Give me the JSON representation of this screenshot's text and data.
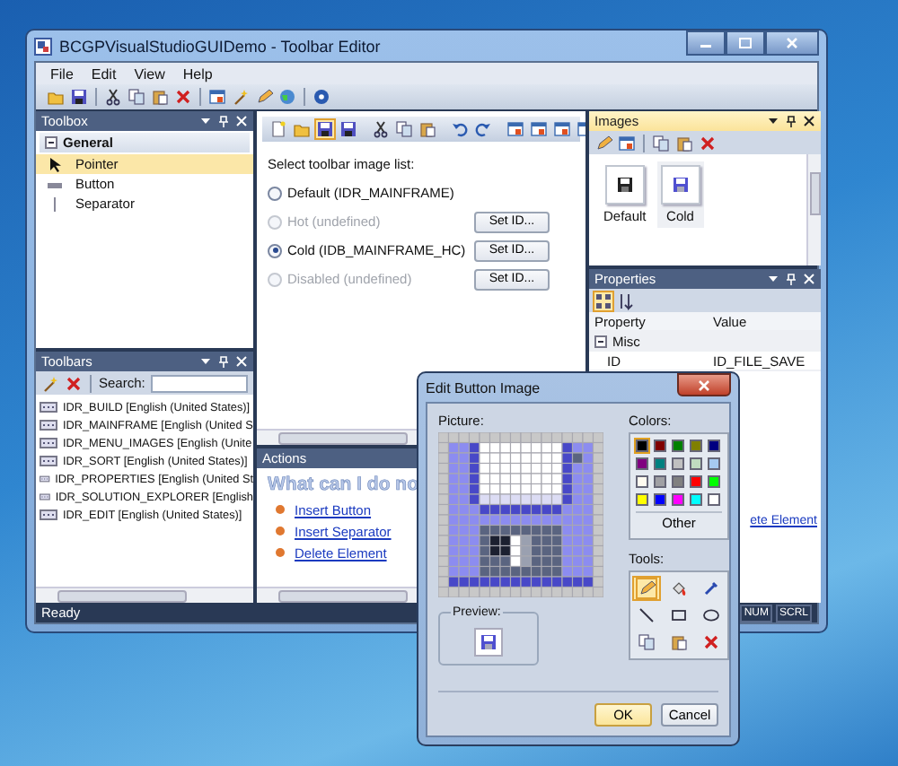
{
  "window": {
    "title": "BCGPVisualStudioGUIDemo - Toolbar Editor"
  },
  "menu": [
    "File",
    "Edit",
    "View",
    "Help"
  ],
  "toolbox": {
    "title": "Toolbox",
    "group": "General",
    "items": [
      {
        "label": "Pointer",
        "kind": "pointer",
        "selected": true
      },
      {
        "label": "Button",
        "kind": "button",
        "selected": false
      },
      {
        "label": "Separator",
        "kind": "separator",
        "selected": false
      }
    ]
  },
  "toolbars": {
    "title": "Toolbars",
    "search_label": "Search:",
    "items": [
      "IDR_BUILD [English (United States)]",
      "IDR_MAINFRAME [English (United S",
      "IDR_MENU_IMAGES [English (Unite",
      "IDR_SORT [English (United States)]",
      "IDR_PROPERTIES [English (United St",
      "IDR_SOLUTION_EXPLORER [English",
      "IDR_EDIT [English (United States)]"
    ]
  },
  "editor": {
    "prompt": "Select toolbar image list:",
    "options": [
      {
        "label": "Default (IDR_MAINFRAME)",
        "selected": false,
        "disabled": false
      },
      {
        "label": "Hot (undefined)",
        "selected": false,
        "disabled": true,
        "button": "Set ID..."
      },
      {
        "label": "Cold (IDB_MAINFRAME_HC)",
        "selected": true,
        "disabled": false,
        "button": "Set ID..."
      },
      {
        "label": "Disabled (undefined)",
        "selected": false,
        "disabled": true,
        "button": "Set ID..."
      }
    ]
  },
  "actions": {
    "title": "Actions",
    "heading": "What can I do no",
    "links": [
      "Insert Button",
      "Insert Separator",
      "Delete Element"
    ]
  },
  "images": {
    "title": "Images",
    "items": [
      {
        "label": "Default",
        "selected": false,
        "kind": "dark"
      },
      {
        "label": "Cold",
        "selected": true,
        "kind": "blue"
      }
    ]
  },
  "properties": {
    "title": "Properties",
    "columns": [
      "Property",
      "Value"
    ],
    "category": "Misc",
    "rows": [
      {
        "property": "ID",
        "value": "ID_FILE_SAVE"
      }
    ],
    "link": "ete Element"
  },
  "status_bar": {
    "text": "Ready",
    "indicators": [
      "NUM",
      "SCRL"
    ]
  },
  "dialog": {
    "title": "Edit Button Image",
    "picture_label": "Picture:",
    "colors_label": "Colors:",
    "colors": [
      {
        "color": "#000000",
        "selected": true
      },
      {
        "color": "#800000",
        "selected": false
      },
      {
        "color": "#008000",
        "selected": false
      },
      {
        "color": "#808000",
        "selected": false
      },
      {
        "color": "#000080",
        "selected": false
      },
      {
        "color": "#800080",
        "selected": false
      },
      {
        "color": "#008080",
        "selected": false
      },
      {
        "color": "#c0c0c0",
        "selected": false
      },
      {
        "color": "#c0dcc0",
        "selected": false
      },
      {
        "color": "#a6caf0",
        "selected": false
      },
      {
        "color": "#fffbf0",
        "selected": false
      },
      {
        "color": "#a0a0a4",
        "selected": false
      },
      {
        "color": "#808080",
        "selected": false
      },
      {
        "color": "#ff0000",
        "selected": false
      },
      {
        "color": "#00ff00",
        "selected": false
      },
      {
        "color": "#ffff00",
        "selected": false
      },
      {
        "color": "#0000ff",
        "selected": false
      },
      {
        "color": "#ff00ff",
        "selected": false
      },
      {
        "color": "#00ffff",
        "selected": false
      },
      {
        "color": "#ffffff",
        "selected": false
      }
    ],
    "other_button": "Other",
    "tools_label": "Tools:",
    "tools": [
      {
        "kind": "pencil",
        "selected": true
      },
      {
        "kind": "fill",
        "selected": false
      },
      {
        "kind": "dropper",
        "selected": false
      },
      {
        "kind": "line",
        "selected": false
      },
      {
        "kind": "rect",
        "selected": false
      },
      {
        "kind": "ellipse",
        "selected": false
      },
      {
        "kind": "copy",
        "selected": false
      },
      {
        "kind": "paste",
        "selected": false
      },
      {
        "kind": "delete",
        "selected": false
      }
    ],
    "preview_label": "Preview:",
    "buttons": [
      {
        "label": "OK",
        "default": true
      },
      {
        "label": "Cancel",
        "default": false
      }
    ]
  }
}
